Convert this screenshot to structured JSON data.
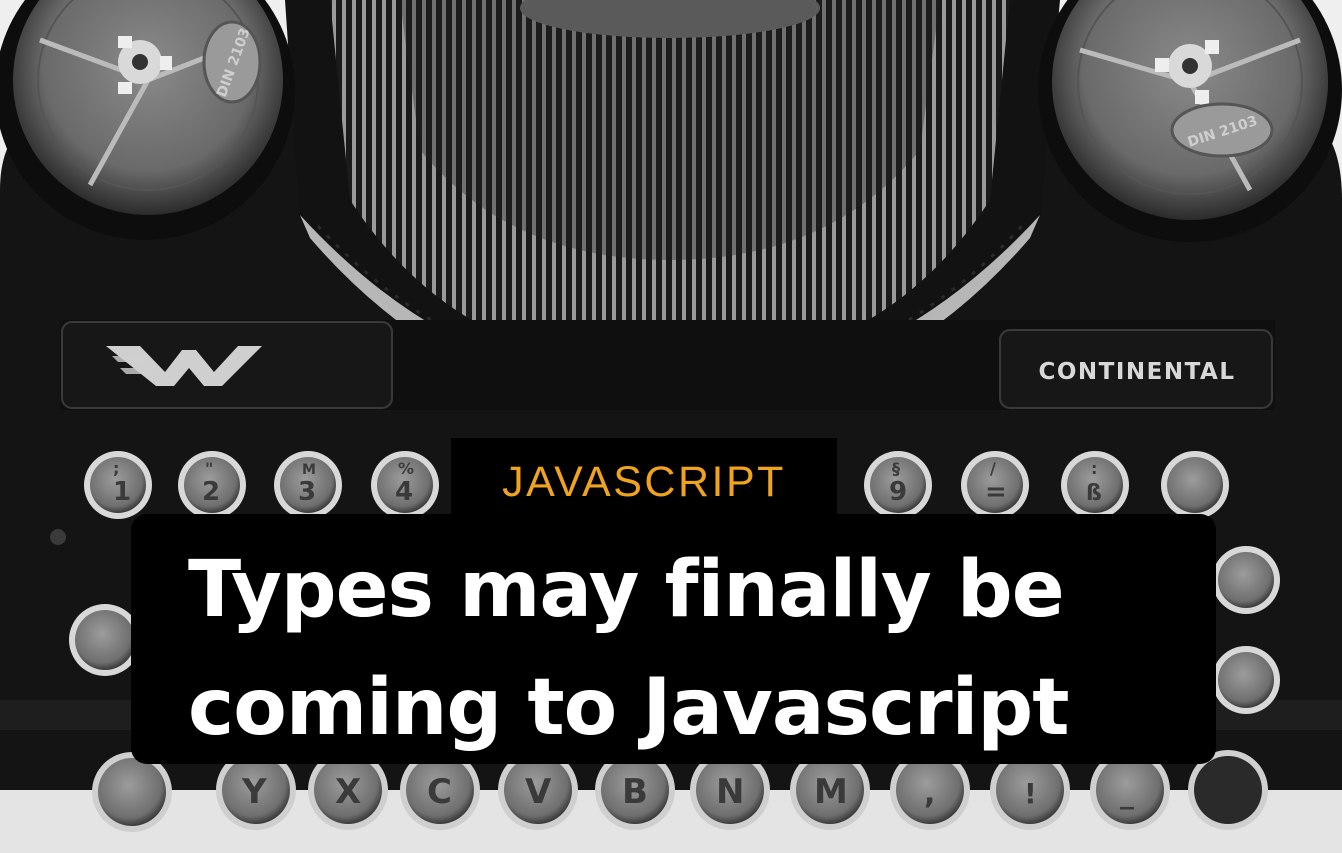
{
  "hero": {
    "category": "JAVASCRIPT",
    "title_lines": [
      "Types may finally be",
      "coming to Javascript"
    ],
    "accent_color": "#f0a31c"
  },
  "photo": {
    "brand": "CONTINENTAL",
    "spool_label": "DIN 2103",
    "key_labels_top": [
      "1",
      "2",
      "3",
      "4",
      "9",
      "=",
      "ß"
    ],
    "key_glyphs_top": [
      ";",
      "\"",
      "M",
      "%",
      "§",
      "/",
      ":"
    ],
    "key_labels_bottom": [
      "Y",
      "X",
      "C",
      "V",
      "B",
      "N",
      "M",
      ",",
      "!",
      "_"
    ]
  }
}
